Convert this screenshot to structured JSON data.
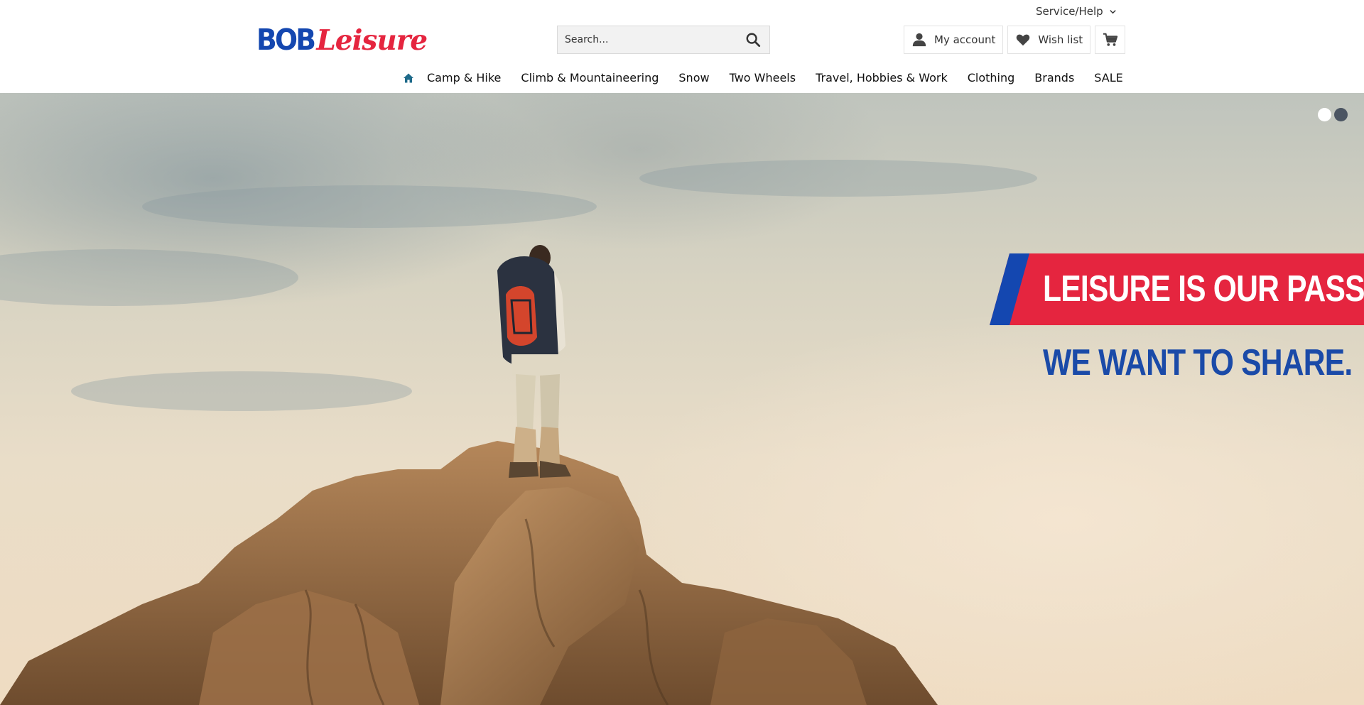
{
  "brand": {
    "logo_part1": "BOB",
    "logo_part2": "Leisure",
    "blue": "#1447b0",
    "red": "#e5253f"
  },
  "top_bar": {
    "service_help": "Service/Help",
    "service_icon": "chevron-down-icon"
  },
  "search": {
    "placeholder": "Search...",
    "icon": "search-icon"
  },
  "account": {
    "my_account": "My account",
    "my_account_icon": "user-icon",
    "wish_list": "Wish list",
    "wish_list_icon": "heart-icon",
    "cart_icon": "cart-icon"
  },
  "nav": {
    "home_icon": "home-icon",
    "items": [
      {
        "label": "Camp & Hike"
      },
      {
        "label": "Climb & Mountaineering"
      },
      {
        "label": "Snow"
      },
      {
        "label": "Two Wheels"
      },
      {
        "label": "Travel, Hobbies & Work"
      },
      {
        "label": "Clothing"
      },
      {
        "label": "Brands"
      },
      {
        "label": "SALE"
      }
    ]
  },
  "hero": {
    "headline": "LEISURE IS OUR PASSION,",
    "tagline": "WE WANT TO SHARE.",
    "slides_total": 2,
    "active_slide": 2,
    "headline_bg": "#e5253f",
    "stripe_color": "#1447b0",
    "tagline_color": "#1a4aa8"
  }
}
